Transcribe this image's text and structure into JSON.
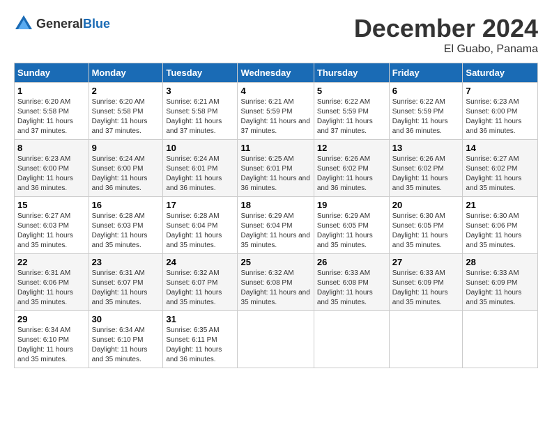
{
  "header": {
    "logo_general": "General",
    "logo_blue": "Blue",
    "month_title": "December 2024",
    "location": "El Guabo, Panama"
  },
  "weekdays": [
    "Sunday",
    "Monday",
    "Tuesday",
    "Wednesday",
    "Thursday",
    "Friday",
    "Saturday"
  ],
  "weeks": [
    [
      {
        "day": "1",
        "sunrise": "6:20 AM",
        "sunset": "5:58 PM",
        "daylight": "11 hours and 37 minutes."
      },
      {
        "day": "2",
        "sunrise": "6:20 AM",
        "sunset": "5:58 PM",
        "daylight": "11 hours and 37 minutes."
      },
      {
        "day": "3",
        "sunrise": "6:21 AM",
        "sunset": "5:58 PM",
        "daylight": "11 hours and 37 minutes."
      },
      {
        "day": "4",
        "sunrise": "6:21 AM",
        "sunset": "5:59 PM",
        "daylight": "11 hours and 37 minutes."
      },
      {
        "day": "5",
        "sunrise": "6:22 AM",
        "sunset": "5:59 PM",
        "daylight": "11 hours and 37 minutes."
      },
      {
        "day": "6",
        "sunrise": "6:22 AM",
        "sunset": "5:59 PM",
        "daylight": "11 hours and 36 minutes."
      },
      {
        "day": "7",
        "sunrise": "6:23 AM",
        "sunset": "6:00 PM",
        "daylight": "11 hours and 36 minutes."
      }
    ],
    [
      {
        "day": "8",
        "sunrise": "6:23 AM",
        "sunset": "6:00 PM",
        "daylight": "11 hours and 36 minutes."
      },
      {
        "day": "9",
        "sunrise": "6:24 AM",
        "sunset": "6:00 PM",
        "daylight": "11 hours and 36 minutes."
      },
      {
        "day": "10",
        "sunrise": "6:24 AM",
        "sunset": "6:01 PM",
        "daylight": "11 hours and 36 minutes."
      },
      {
        "day": "11",
        "sunrise": "6:25 AM",
        "sunset": "6:01 PM",
        "daylight": "11 hours and 36 minutes."
      },
      {
        "day": "12",
        "sunrise": "6:26 AM",
        "sunset": "6:02 PM",
        "daylight": "11 hours and 36 minutes."
      },
      {
        "day": "13",
        "sunrise": "6:26 AM",
        "sunset": "6:02 PM",
        "daylight": "11 hours and 35 minutes."
      },
      {
        "day": "14",
        "sunrise": "6:27 AM",
        "sunset": "6:02 PM",
        "daylight": "11 hours and 35 minutes."
      }
    ],
    [
      {
        "day": "15",
        "sunrise": "6:27 AM",
        "sunset": "6:03 PM",
        "daylight": "11 hours and 35 minutes."
      },
      {
        "day": "16",
        "sunrise": "6:28 AM",
        "sunset": "6:03 PM",
        "daylight": "11 hours and 35 minutes."
      },
      {
        "day": "17",
        "sunrise": "6:28 AM",
        "sunset": "6:04 PM",
        "daylight": "11 hours and 35 minutes."
      },
      {
        "day": "18",
        "sunrise": "6:29 AM",
        "sunset": "6:04 PM",
        "daylight": "11 hours and 35 minutes."
      },
      {
        "day": "19",
        "sunrise": "6:29 AM",
        "sunset": "6:05 PM",
        "daylight": "11 hours and 35 minutes."
      },
      {
        "day": "20",
        "sunrise": "6:30 AM",
        "sunset": "6:05 PM",
        "daylight": "11 hours and 35 minutes."
      },
      {
        "day": "21",
        "sunrise": "6:30 AM",
        "sunset": "6:06 PM",
        "daylight": "11 hours and 35 minutes."
      }
    ],
    [
      {
        "day": "22",
        "sunrise": "6:31 AM",
        "sunset": "6:06 PM",
        "daylight": "11 hours and 35 minutes."
      },
      {
        "day": "23",
        "sunrise": "6:31 AM",
        "sunset": "6:07 PM",
        "daylight": "11 hours and 35 minutes."
      },
      {
        "day": "24",
        "sunrise": "6:32 AM",
        "sunset": "6:07 PM",
        "daylight": "11 hours and 35 minutes."
      },
      {
        "day": "25",
        "sunrise": "6:32 AM",
        "sunset": "6:08 PM",
        "daylight": "11 hours and 35 minutes."
      },
      {
        "day": "26",
        "sunrise": "6:33 AM",
        "sunset": "6:08 PM",
        "daylight": "11 hours and 35 minutes."
      },
      {
        "day": "27",
        "sunrise": "6:33 AM",
        "sunset": "6:09 PM",
        "daylight": "11 hours and 35 minutes."
      },
      {
        "day": "28",
        "sunrise": "6:33 AM",
        "sunset": "6:09 PM",
        "daylight": "11 hours and 35 minutes."
      }
    ],
    [
      {
        "day": "29",
        "sunrise": "6:34 AM",
        "sunset": "6:10 PM",
        "daylight": "11 hours and 35 minutes."
      },
      {
        "day": "30",
        "sunrise": "6:34 AM",
        "sunset": "6:10 PM",
        "daylight": "11 hours and 35 minutes."
      },
      {
        "day": "31",
        "sunrise": "6:35 AM",
        "sunset": "6:11 PM",
        "daylight": "11 hours and 36 minutes."
      },
      null,
      null,
      null,
      null
    ]
  ],
  "labels": {
    "sunrise": "Sunrise:",
    "sunset": "Sunset:",
    "daylight": "Daylight:"
  }
}
